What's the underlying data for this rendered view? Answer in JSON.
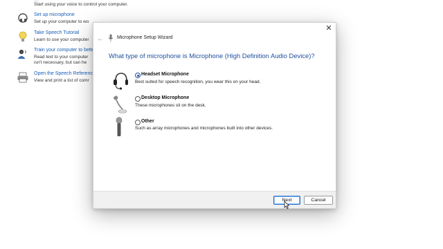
{
  "background": {
    "top_strip": "...",
    "items": [
      {
        "link": "",
        "desc1": "Start using your voice to control your computer.",
        "desc2": ""
      },
      {
        "link": "Set up microphone",
        "desc1": "Set up your computer to wo",
        "desc2": ""
      },
      {
        "link": "Take Speech Tutorial",
        "desc1": "Learn to use your computer",
        "desc2": ""
      },
      {
        "link": "Train your computer to bette",
        "desc1": "Read text to your computer",
        "desc2": "isn't necessary, but can he"
      },
      {
        "link": "Open the Speech Reference",
        "desc1": "View and print a list of comr",
        "desc2": ""
      }
    ]
  },
  "dialog": {
    "title": "Microphone Setup Wizard",
    "back_icon": "back-arrow-icon",
    "close_glyph": "✕",
    "question": "What type of microphone is Microphone (High Definition Audio Device)?",
    "options": [
      {
        "label": "Headset Microphone",
        "desc": "Best suited for speech recognition, you wear this on your head.",
        "icon": "headset-icon",
        "selected": true
      },
      {
        "label": "Desktop Microphone",
        "desc": "These microphones sit on the desk.",
        "icon": "desktop-microphone-icon",
        "selected": false
      },
      {
        "label": "Other",
        "desc": "Such as array microphones and microphones built into other devices.",
        "icon": "handheld-microphone-icon",
        "selected": false
      }
    ],
    "buttons": {
      "next": "Next",
      "cancel": "Cancel"
    }
  },
  "colors": {
    "link": "#1a5fb4",
    "question": "#1f4e9d",
    "accent_button": "#1a6fd0"
  }
}
